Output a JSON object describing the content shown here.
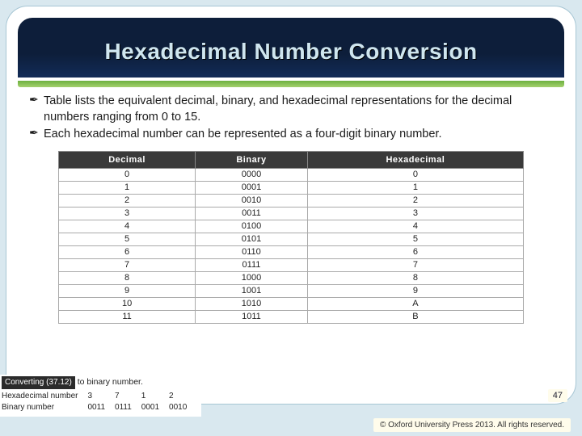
{
  "header": {
    "title": "Hexadecimal Number Conversion"
  },
  "bullets": [
    "Table lists the equivalent decimal, binary, and hexadecimal representations for the decimal numbers ranging from 0 to 15.",
    "Each hexadecimal number can be represented as a four-digit binary number."
  ],
  "table": {
    "headers": [
      "Decimal",
      "Binary",
      "Hexadecimal"
    ],
    "rows": [
      [
        "0",
        "0000",
        "0"
      ],
      [
        "1",
        "0001",
        "1"
      ],
      [
        "2",
        "0010",
        "2"
      ],
      [
        "3",
        "0011",
        "3"
      ],
      [
        "4",
        "0100",
        "4"
      ],
      [
        "5",
        "0101",
        "5"
      ],
      [
        "6",
        "0110",
        "6"
      ],
      [
        "7",
        "0111",
        "7"
      ],
      [
        "8",
        "1000",
        "8"
      ],
      [
        "9",
        "1001",
        "9"
      ],
      [
        "10",
        "1010",
        "A"
      ],
      [
        "11",
        "1011",
        "B"
      ]
    ]
  },
  "overlay": {
    "caption_prefix": "Converting (37.12)",
    "caption_suffix": " to binary number.",
    "row_labels": [
      "Hexadecimal number",
      "Binary number"
    ],
    "hex_digits": [
      "3",
      "7",
      "1",
      "2"
    ],
    "bin_groups": [
      "0011",
      "0111",
      "0001",
      "0010"
    ]
  },
  "page_number": "47",
  "copyright": "© Oxford University Press 2013. All rights reserved.",
  "chart_data": {
    "type": "table",
    "title": "Decimal / Binary / Hexadecimal equivalents (0–11 shown)",
    "columns": [
      "Decimal",
      "Binary",
      "Hexadecimal"
    ],
    "rows": [
      [
        0,
        "0000",
        "0"
      ],
      [
        1,
        "0001",
        "1"
      ],
      [
        2,
        "0010",
        "2"
      ],
      [
        3,
        "0011",
        "3"
      ],
      [
        4,
        "0100",
        "4"
      ],
      [
        5,
        "0101",
        "5"
      ],
      [
        6,
        "0110",
        "6"
      ],
      [
        7,
        "0111",
        "7"
      ],
      [
        8,
        "1000",
        "8"
      ],
      [
        9,
        "1001",
        "9"
      ],
      [
        10,
        "1010",
        "A"
      ],
      [
        11,
        "1011",
        "B"
      ]
    ]
  }
}
